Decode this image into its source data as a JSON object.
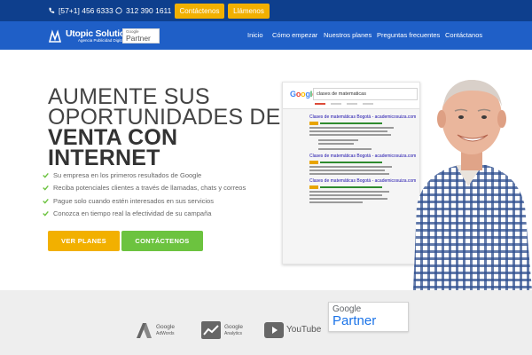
{
  "topbar": {
    "phone": "[57+1] 456 6333",
    "whatsapp": "312 390 1611",
    "contact_button": "Contáctenos",
    "call_button": "Llámenos"
  },
  "nav": {
    "logo_name": "Utopic Solution",
    "logo_tagline": "Agencia Publicidad Digital",
    "partner_small": "Google",
    "partner_big": "Partner",
    "menu": [
      "Inicio",
      "Cómo empezar",
      "Nuestros planes",
      "Preguntas frecuentes",
      "Contáctanos"
    ]
  },
  "hero": {
    "headline": [
      "AUMENTE SUS",
      "OPORTUNIDADES DE",
      "VENTA CON",
      "INTERNET"
    ],
    "bullets": [
      "Su empresa en los primeros resultados de Google",
      "Reciba potenciales clientes a través de llamadas, chats y correos",
      "Pague solo cuando estén interesados en sus servicios",
      "Conozca en tiempo real la efectividad de su campaña"
    ],
    "plans_button": "VER PLANES",
    "contact_button": "CONTÁCTENOS"
  },
  "search_mock": {
    "logo": "Google",
    "query": "clases de matematicas",
    "results": [
      "Clases de matemáticas Bogotá - academicosuiza.com",
      "Clases de matemáticas Bogotá - academicosuiza.com",
      "Clases de matemáticas Bogotá - academicosuiza.com"
    ]
  },
  "brands": {
    "adwords_name": "Google",
    "adwords_product": "AdWords",
    "analytics_name": "Google",
    "analytics_product": "Analytics",
    "youtube": "YouTube",
    "partner_small": "Google",
    "partner_big": "Partner"
  },
  "colors": {
    "topbar": "#0e3f8d",
    "nav": "#1f5fc7",
    "yellow": "#f2b000",
    "green": "#6cc33f",
    "check": "#6cc33f"
  }
}
